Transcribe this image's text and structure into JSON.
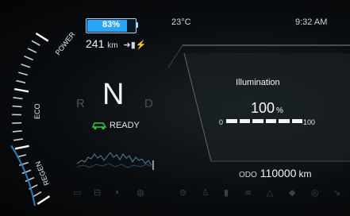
{
  "status": {
    "battery_percent_label": "83%",
    "battery_level": 0.83,
    "range_value": "241",
    "range_unit": "km",
    "range_icon": "charging-range-icon",
    "temperature": "23°C",
    "time": "9:32 AM"
  },
  "power_gauge": {
    "labels": [
      "POWER",
      "ECO",
      "REGEN"
    ]
  },
  "drive": {
    "gear_reverse": "R",
    "gear_current": "N",
    "gear_drive": "D",
    "ready_label": "READY",
    "ready_color": "#2ecc40"
  },
  "illumination": {
    "title": "Illumination",
    "value": "100",
    "unit": "%",
    "min": "0",
    "max": "100",
    "level": 1.0
  },
  "odometer": {
    "label": "ODO",
    "value": "110000",
    "unit": "km"
  },
  "telltales": [
    "parking-light-icon",
    "battery-warning-icon",
    "low-beam-icon",
    "tire-pressure-icon",
    "brake-icon",
    "seatbelt-icon",
    "fuel-door-icon",
    "tow-icon",
    "warning-triangle-icon",
    "ev-charge-icon",
    "lane-assist-icon",
    "traction-icon"
  ],
  "colors": {
    "accent": "#2aa4f4",
    "ready": "#2ecc40",
    "background": "#050708"
  }
}
